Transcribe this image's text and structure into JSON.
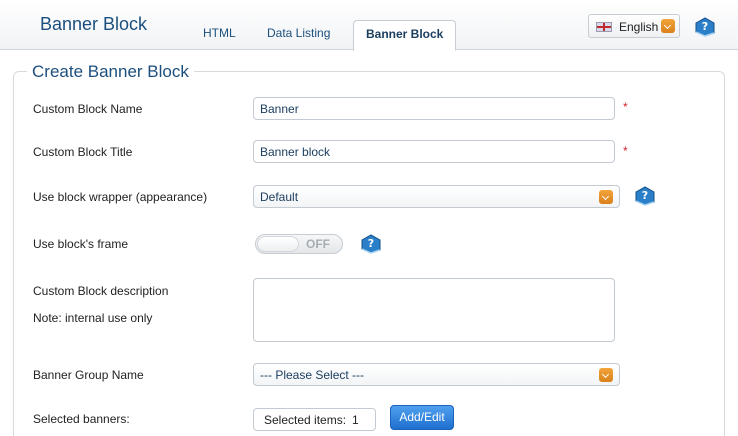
{
  "header": {
    "app_title": "Banner Block",
    "tabs": [
      {
        "label": "HTML",
        "active": false
      },
      {
        "label": "Data Listing",
        "active": false
      },
      {
        "label": "Banner Block",
        "active": true
      }
    ],
    "language": {
      "label": "English",
      "flag": "uk-flag-icon"
    },
    "help_icon": "help-book-icon"
  },
  "form": {
    "title": "Create Banner Block",
    "fields": {
      "name": {
        "label": "Custom Block Name",
        "value": "Banner",
        "required": "*"
      },
      "title": {
        "label": "Custom Block Title",
        "value": "Banner block",
        "required": "*"
      },
      "wrapper": {
        "label": "Use block wrapper (appearance)",
        "value": "Default"
      },
      "frame": {
        "label": "Use block's frame",
        "state": "OFF"
      },
      "description": {
        "label": "Custom Block description",
        "note": "Note: internal use only",
        "value": ""
      },
      "group": {
        "label": "Banner Group Name",
        "value": "--- Please Select ---"
      },
      "banners": {
        "label": "Selected banners:",
        "items_label": "Selected items:",
        "count": "1",
        "button": "Add/Edit"
      }
    }
  },
  "colors": {
    "accent": "#1c4f7d",
    "required": "#d4222a",
    "dropdown": "#e38b22",
    "button": "#2a7ad8"
  }
}
